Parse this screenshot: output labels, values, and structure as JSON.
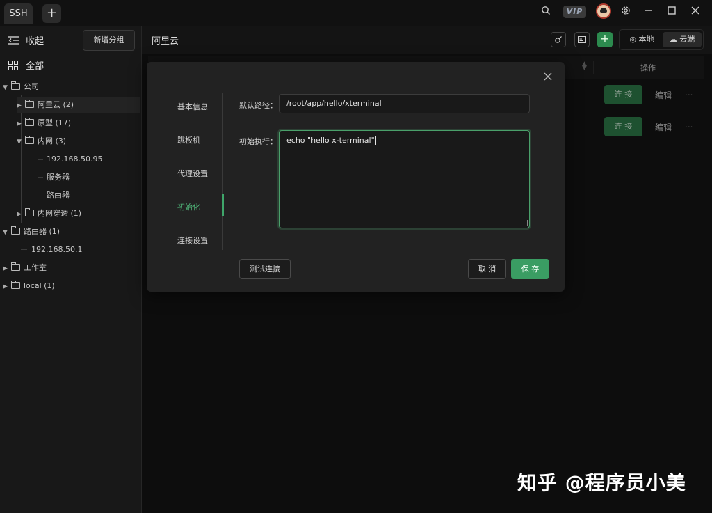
{
  "titlebar": {
    "tab_label": "SSH",
    "add_tab_label": "+",
    "vip_label": "VIP",
    "icons": [
      "search-icon",
      "gear-icon",
      "minimize-icon",
      "maximize-icon",
      "close-icon"
    ]
  },
  "sidebar": {
    "collapse_label": "收起",
    "new_group_label": "新增分组",
    "all_label": "全部",
    "tree": {
      "company": "公司",
      "aliyun": "阿里云 (2)",
      "prototype": "原型 (17)",
      "intranet": "内网 (3)",
      "ip1": "192.168.50.95",
      "server": "服务器",
      "router_item": "路由器",
      "penetration": "内网穿透 (1)",
      "router_group": "路由器 (1)",
      "ip2": "192.168.50.1",
      "studio": "工作室",
      "local": "local (1)"
    }
  },
  "main": {
    "title": "阿里云",
    "segment": {
      "local": "本地",
      "cloud": "云端"
    },
    "table": {
      "op_header": "操作",
      "rows": [
        {
          "connect": "连 接",
          "edit": "编辑",
          "more": "..."
        },
        {
          "connect": "连 接",
          "edit": "编辑",
          "more": "..."
        }
      ]
    }
  },
  "dialog": {
    "nav": {
      "basic": "基本信息",
      "jump": "跳板机",
      "proxy": "代理设置",
      "init": "初始化",
      "connection": "连接设置"
    },
    "path_label": "默认路径：",
    "path_value": "/root/app/hello/xterminal",
    "exec_label": "初始执行：",
    "exec_value": "echo \"hello x-terminal\"",
    "test_button": "测试连接",
    "cancel_button": "取 消",
    "save_button": "保 存"
  },
  "watermark": "知乎 @程序员小美",
  "colors": {
    "accent": "#3a9d63",
    "active_nav": "#4fb277",
    "background": "#141414"
  }
}
